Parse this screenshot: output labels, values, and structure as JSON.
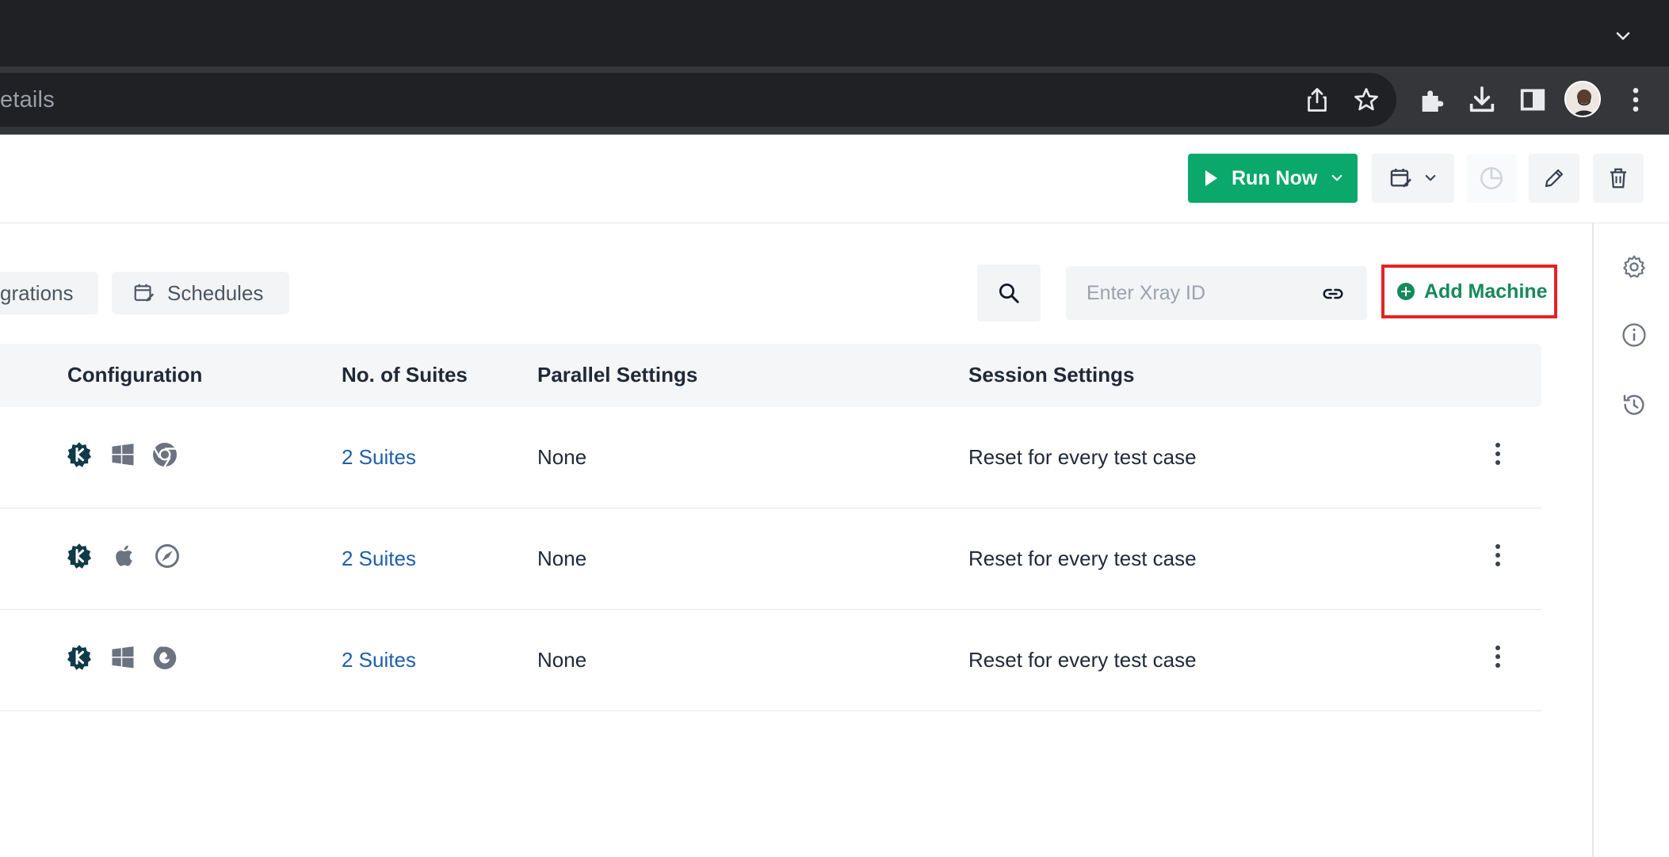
{
  "browser": {
    "url_fragment": "etails"
  },
  "header": {
    "run_now_label": "Run Now"
  },
  "toolbar": {
    "tabs": [
      {
        "label": "grations"
      },
      {
        "label": "Schedules"
      }
    ],
    "xray_placeholder": "Enter Xray ID",
    "add_machine_label": "Add Machine"
  },
  "table": {
    "columns": [
      "Configuration",
      "No. of Suites",
      "Parallel Settings",
      "Session Settings"
    ],
    "rows": [
      {
        "config_icons": [
          "katalon-icon",
          "windows-icon",
          "chrome-icon"
        ],
        "suites": "2 Suites",
        "parallel": "None",
        "session": "Reset for every test case"
      },
      {
        "config_icons": [
          "katalon-icon",
          "apple-icon",
          "safari-icon"
        ],
        "suites": "2 Suites",
        "parallel": "None",
        "session": "Reset for every test case"
      },
      {
        "config_icons": [
          "katalon-icon",
          "windows-icon",
          "firefox-icon"
        ],
        "suites": "2 Suites",
        "parallel": "None",
        "session": "Reset for every test case"
      }
    ]
  },
  "colors": {
    "primary_green": "#0aa86a",
    "add_machine_green": "#16895a",
    "highlight_red": "#e52222",
    "link_blue": "#1f5fa8",
    "chrome_dark": "#202124"
  }
}
